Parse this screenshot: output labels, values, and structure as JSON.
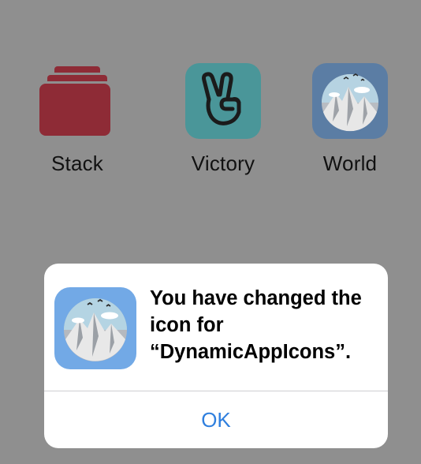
{
  "home_screen": {
    "apps": [
      {
        "label": "Stack",
        "icon": "stack-icon",
        "color": "#8e2b36"
      },
      {
        "label": "Victory",
        "icon": "victory-hand-icon",
        "color": "#4a9699"
      },
      {
        "label": "World",
        "icon": "globe-mountain-icon",
        "color": "#5b7da4"
      }
    ]
  },
  "alert": {
    "icon": "globe-mountain-icon",
    "message_line1": "You have changed the",
    "message_line2": "icon for",
    "message_line3": "“DynamicAppIcons”.",
    "ok_label": "OK",
    "accent_color": "#2f7fde"
  }
}
